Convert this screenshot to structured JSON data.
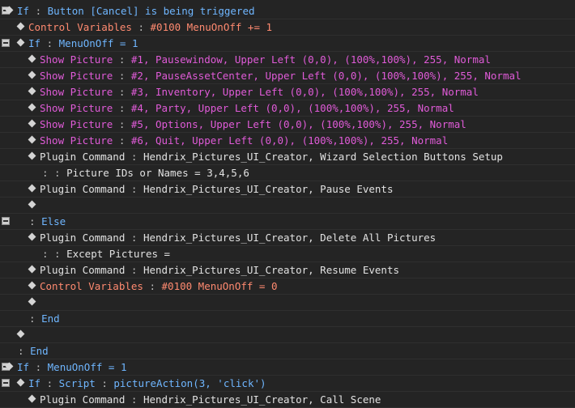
{
  "rows": [
    {
      "parts": [
        {
          "t": "If",
          "c": "blue"
        },
        {
          "t": " : ",
          "c": "sep"
        },
        {
          "t": "Button [Cancel] is being triggered",
          "c": "blue"
        }
      ]
    },
    {
      "parts": [
        {
          "t": "Control Variables",
          "c": "orange"
        },
        {
          "t": " : ",
          "c": "sep"
        },
        {
          "t": "#0100 MenuOnOff += 1",
          "c": "orange"
        }
      ]
    },
    {
      "parts": [
        {
          "t": "If",
          "c": "blue"
        },
        {
          "t": " : ",
          "c": "sep"
        },
        {
          "t": "MenuOnOff = 1",
          "c": "blue"
        }
      ]
    },
    {
      "parts": [
        {
          "t": "Show Picture",
          "c": "magenta"
        },
        {
          "t": " : ",
          "c": "sep"
        },
        {
          "t": "#1, Pausewindow, Upper Left (0,0), (100%,100%), 255, Normal",
          "c": "magenta"
        }
      ]
    },
    {
      "parts": [
        {
          "t": "Show Picture",
          "c": "magenta"
        },
        {
          "t": " : ",
          "c": "sep"
        },
        {
          "t": "#2, PauseAssetCenter, Upper Left (0,0), (100%,100%), 255, Normal",
          "c": "magenta"
        }
      ]
    },
    {
      "parts": [
        {
          "t": "Show Picture",
          "c": "magenta"
        },
        {
          "t": " : ",
          "c": "sep"
        },
        {
          "t": "#3, Inventory, Upper Left (0,0), (100%,100%), 255, Normal",
          "c": "magenta"
        }
      ]
    },
    {
      "parts": [
        {
          "t": "Show Picture",
          "c": "magenta"
        },
        {
          "t": " : ",
          "c": "sep"
        },
        {
          "t": "#4, Party, Upper Left (0,0), (100%,100%), 255, Normal",
          "c": "magenta"
        }
      ]
    },
    {
      "parts": [
        {
          "t": "Show Picture",
          "c": "magenta"
        },
        {
          "t": " : ",
          "c": "sep"
        },
        {
          "t": "#5, Options, Upper Left (0,0), (100%,100%), 255, Normal",
          "c": "magenta"
        }
      ]
    },
    {
      "parts": [
        {
          "t": "Show Picture",
          "c": "magenta"
        },
        {
          "t": " : ",
          "c": "sep"
        },
        {
          "t": "#6, Quit, Upper Left (0,0), (100%,100%), 255, Normal",
          "c": "magenta"
        }
      ]
    },
    {
      "parts": [
        {
          "t": "Plugin Command",
          "c": "white"
        },
        {
          "t": " : ",
          "c": "sep"
        },
        {
          "t": "Hendrix_Pictures_UI_Creator, Wizard Selection Buttons Setup",
          "c": "white"
        }
      ]
    },
    {
      "parts": [
        {
          "t": ":",
          "c": "gray"
        },
        {
          "t": "               : ",
          "c": "sep"
        },
        {
          "t": "Picture IDs or Names = 3,4,5,6",
          "c": "white"
        }
      ]
    },
    {
      "parts": [
        {
          "t": "Plugin Command",
          "c": "white"
        },
        {
          "t": " : ",
          "c": "sep"
        },
        {
          "t": "Hendrix_Pictures_UI_Creator, Pause Events",
          "c": "white"
        }
      ]
    },
    {
      "parts": []
    },
    {
      "parts": [
        {
          "t": ": ",
          "c": "gray"
        },
        {
          "t": "Else",
          "c": "blue"
        }
      ]
    },
    {
      "parts": [
        {
          "t": "Plugin Command",
          "c": "white"
        },
        {
          "t": " : ",
          "c": "sep"
        },
        {
          "t": "Hendrix_Pictures_UI_Creator, Delete All Pictures",
          "c": "white"
        }
      ]
    },
    {
      "parts": [
        {
          "t": ":",
          "c": "gray"
        },
        {
          "t": "               : ",
          "c": "sep"
        },
        {
          "t": "Except Pictures =",
          "c": "white"
        }
      ]
    },
    {
      "parts": [
        {
          "t": "Plugin Command",
          "c": "white"
        },
        {
          "t": " : ",
          "c": "sep"
        },
        {
          "t": "Hendrix_Pictures_UI_Creator, Resume Events",
          "c": "white"
        }
      ]
    },
    {
      "parts": [
        {
          "t": "Control Variables",
          "c": "orange"
        },
        {
          "t": " : ",
          "c": "sep"
        },
        {
          "t": "#0100 MenuOnOff = 0",
          "c": "orange"
        }
      ]
    },
    {
      "parts": []
    },
    {
      "parts": [
        {
          "t": ": ",
          "c": "gray"
        },
        {
          "t": "End",
          "c": "blue"
        }
      ]
    },
    {
      "parts": []
    },
    {
      "parts": [
        {
          "t": ": ",
          "c": "gray"
        },
        {
          "t": "End",
          "c": "blue"
        }
      ]
    },
    {
      "parts": [
        {
          "t": "If",
          "c": "blue"
        },
        {
          "t": " : ",
          "c": "sep"
        },
        {
          "t": "MenuOnOff = 1",
          "c": "blue"
        }
      ]
    },
    {
      "parts": [
        {
          "t": "If",
          "c": "blue"
        },
        {
          "t": " : ",
          "c": "sep"
        },
        {
          "t": "Script",
          "c": "blue"
        },
        {
          "t": " : ",
          "c": "sep"
        },
        {
          "t": "pictureAction(3, 'click')",
          "c": "blue"
        }
      ]
    },
    {
      "parts": [
        {
          "t": "Plugin Command",
          "c": "white"
        },
        {
          "t": " : ",
          "c": "sep"
        },
        {
          "t": "Hendrix_Pictures_UI_Creator, Call Scene",
          "c": "white"
        }
      ]
    }
  ]
}
